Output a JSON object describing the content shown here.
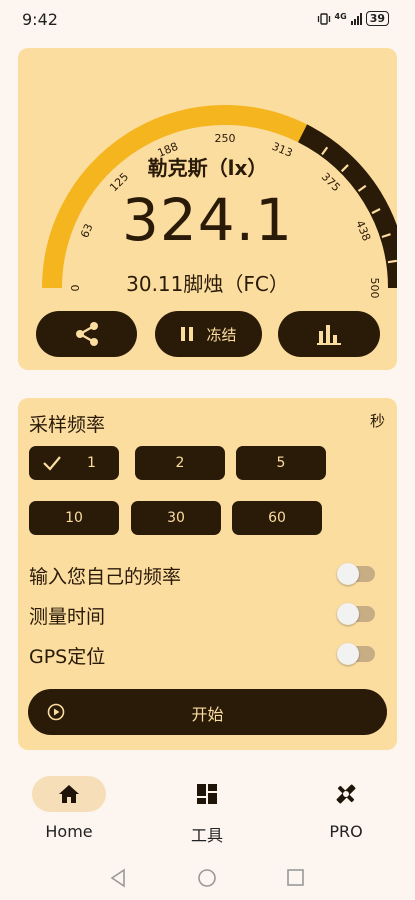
{
  "status_bar": {
    "time": "9:42",
    "network": "4G",
    "battery": "39"
  },
  "meter": {
    "unit_label": "勒克斯（lx）",
    "reading": "324.1",
    "reading_fraction": 0.648,
    "fc_label": "30.11脚烛（FC）",
    "scale_ticks": [
      "0",
      "63",
      "125",
      "188",
      "250",
      "313",
      "375",
      "438",
      "500"
    ],
    "colors": {
      "active": "#f4b51e",
      "track": "#2a1a08",
      "card": "#fcdda0"
    }
  },
  "actions": {
    "share_icon": "share-icon",
    "freeze_label": "冻结",
    "freeze_icon": "pause-icon",
    "chart_icon": "bar-chart-icon"
  },
  "sampling": {
    "title": "采样频率",
    "unit": "秒",
    "options": [
      "1",
      "2",
      "5",
      "10",
      "30",
      "60"
    ],
    "selected": "1",
    "toggles": [
      {
        "label": "输入您自己的频率",
        "on": false
      },
      {
        "label": "测量时间",
        "on": false
      },
      {
        "label": "GPS定位",
        "on": false
      }
    ],
    "start_label": "开始"
  },
  "bottom_nav": [
    {
      "label": "Home",
      "icon": "home-icon",
      "active": true
    },
    {
      "label": "工具",
      "icon": "grid-icon",
      "active": false
    },
    {
      "label": "PRO",
      "icon": "tools-icon",
      "active": false
    }
  ]
}
